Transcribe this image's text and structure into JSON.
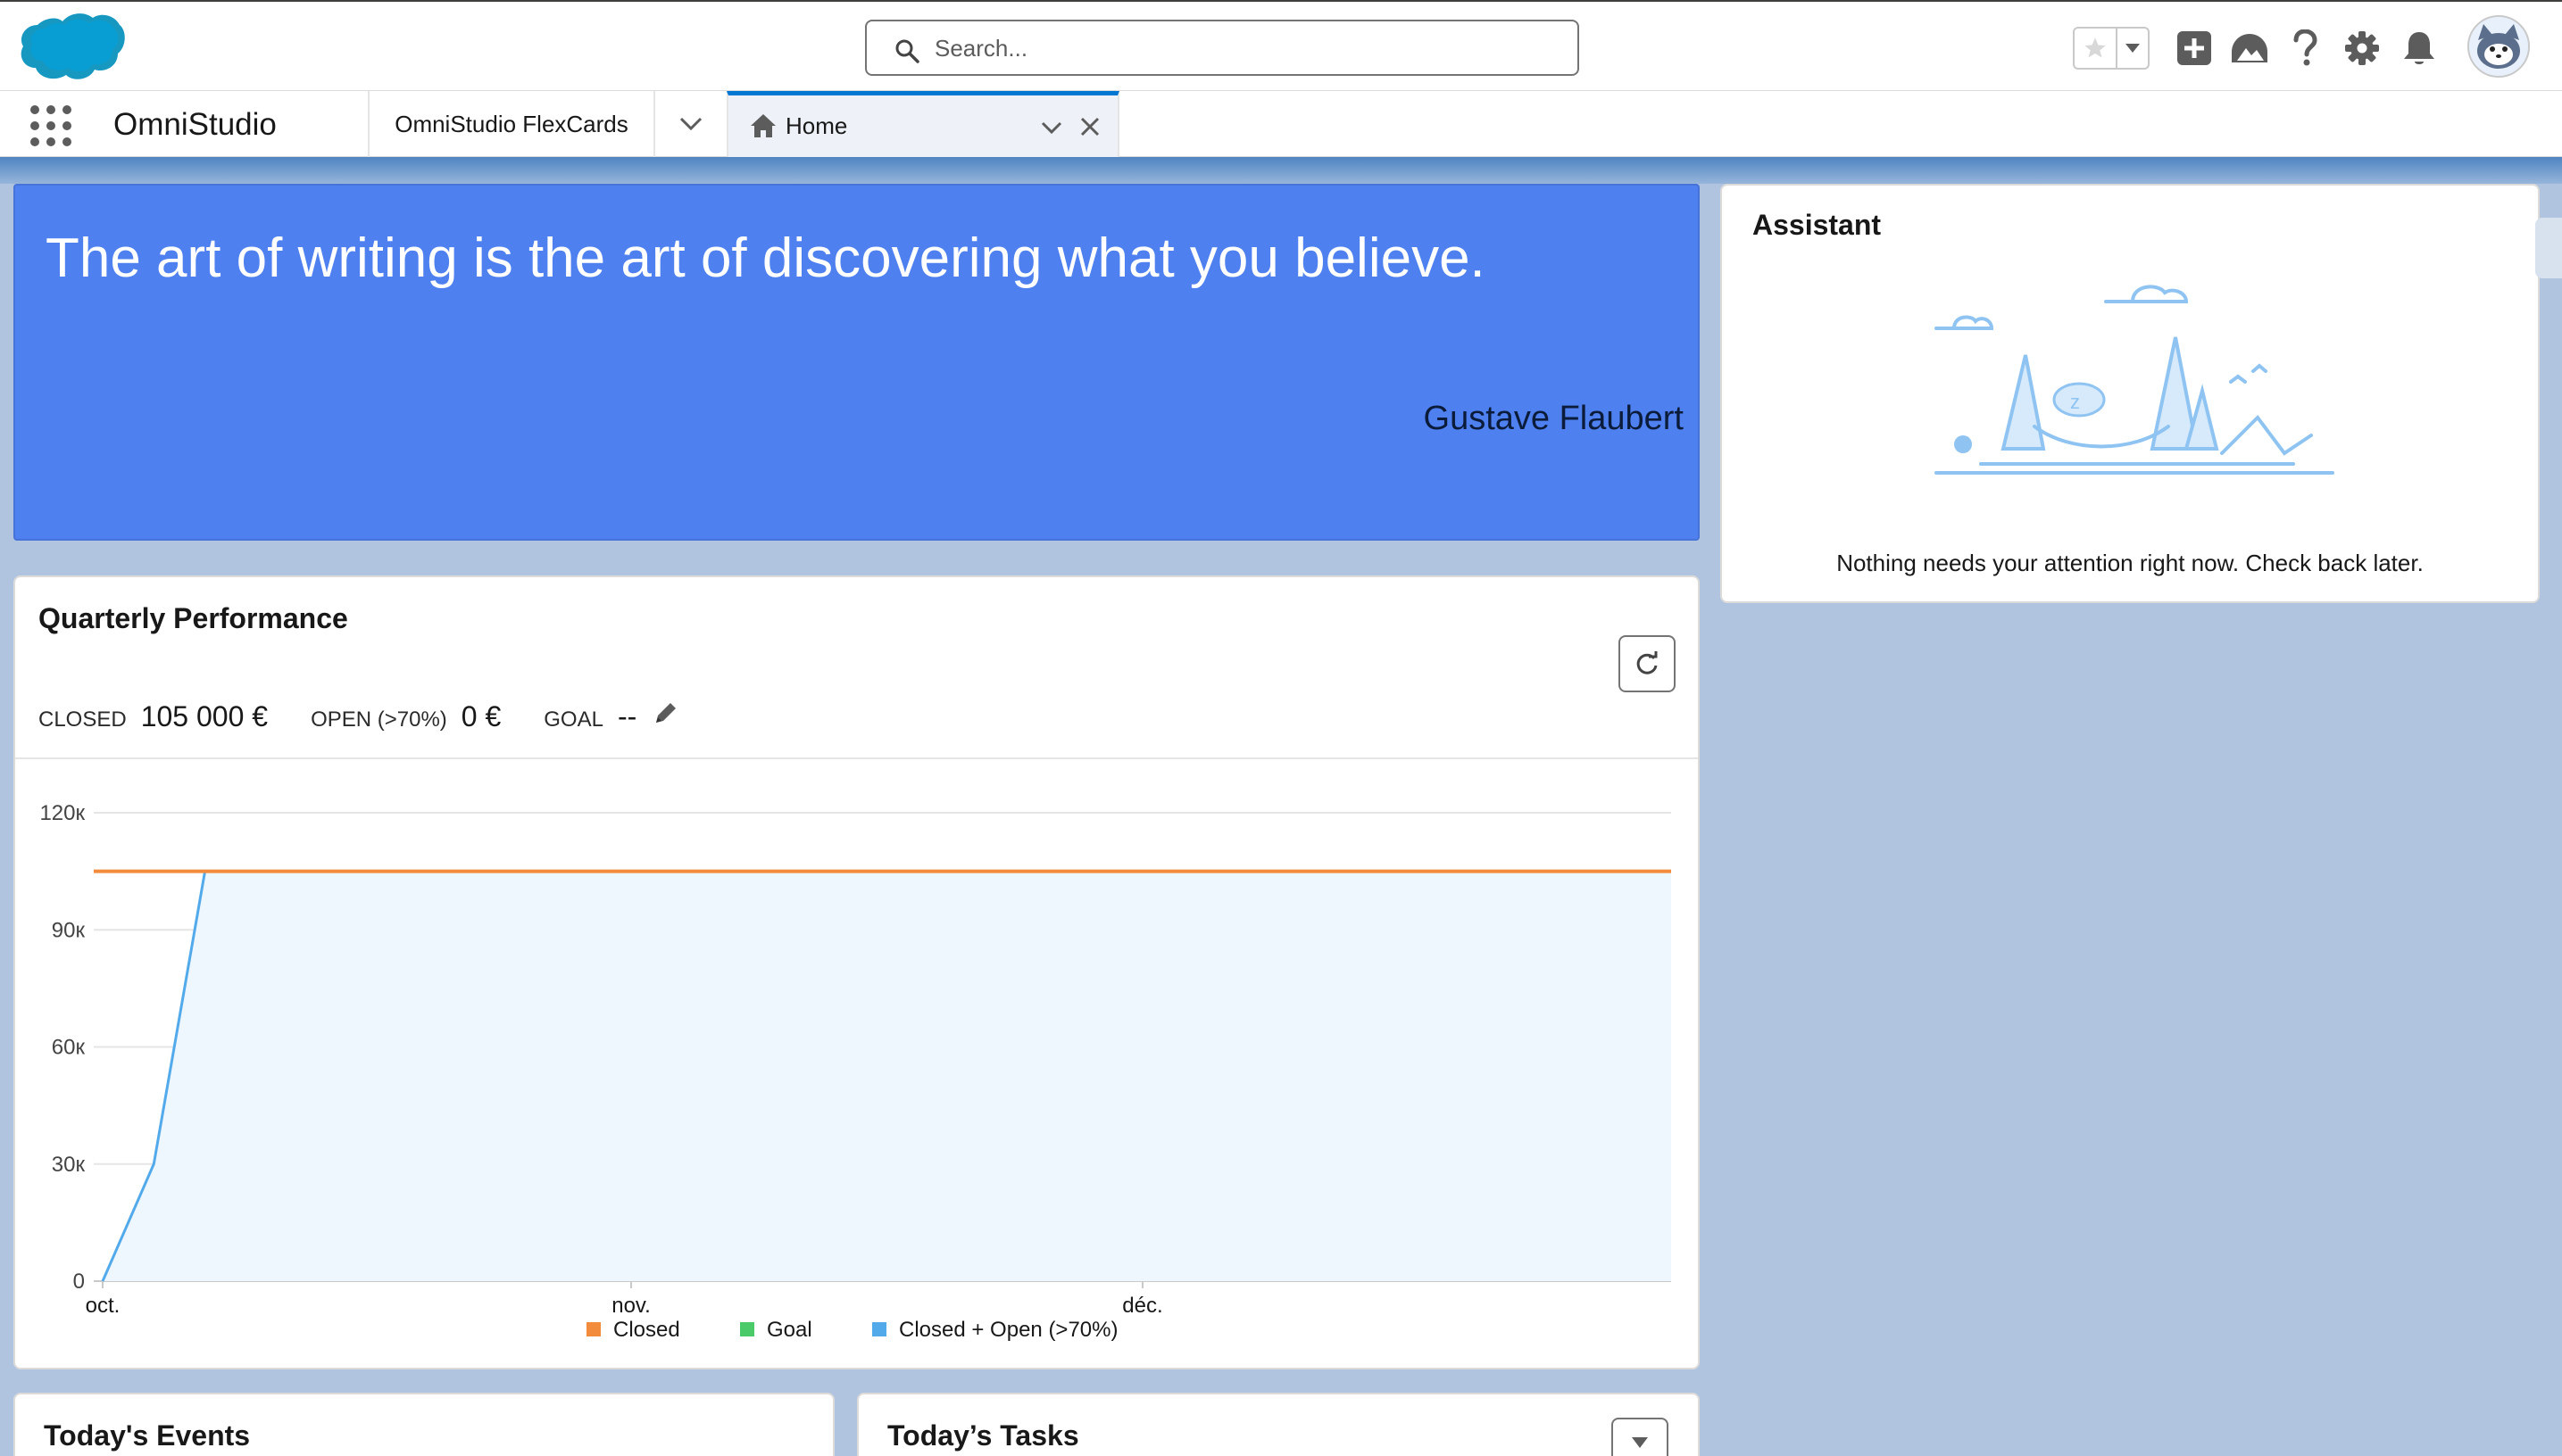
{
  "header": {
    "search_placeholder": "Search...",
    "icons": [
      "salesforce-cloud-logo",
      "search-icon",
      "favorite-star-icon",
      "chevron-down-icon",
      "global-add-icon",
      "trailhead-icon",
      "help-icon",
      "setup-gear-icon",
      "notification-bell-icon",
      "user-avatar"
    ]
  },
  "nav": {
    "app_name": "OmniStudio",
    "tabs": [
      {
        "label": "OmniStudio FlexCards"
      },
      {
        "label": "Home",
        "active": true
      }
    ]
  },
  "quote": {
    "text": "The art of writing is the art of discovering what you believe.",
    "author": "Gustave Flaubert",
    "background_color": "#4f80ef"
  },
  "assistant": {
    "title": "Assistant",
    "message": "Nothing needs your attention right now. Check back later."
  },
  "performance": {
    "title": "Quarterly Performance",
    "closed_label": "CLOSED",
    "closed_value": "105 000 €",
    "open_label": "OPEN (>70%)",
    "open_value": "0 €",
    "goal_label": "GOAL",
    "goal_value": "--"
  },
  "chart_data": {
    "type": "area",
    "x_ticks": [
      "oct.",
      "nov.",
      "déc."
    ],
    "y_ticks": [
      "0",
      "30к",
      "60к",
      "90к",
      "120к"
    ],
    "ylim": [
      0,
      120000
    ],
    "grid": true,
    "legend_position": "bottom",
    "series": [
      {
        "name": "Closed",
        "color": "#f28b3c",
        "x": [
          0,
          92
        ],
        "values": [
          105000,
          105000
        ]
      },
      {
        "name": "Goal",
        "color": "#4bca6a",
        "x": [],
        "values": []
      },
      {
        "name": "Closed + Open (>70%)",
        "color": "#52aaeb",
        "x": [
          0,
          3,
          6,
          92
        ],
        "values": [
          0,
          30000,
          105000,
          105000
        ]
      }
    ],
    "x_range_days": [
      0,
      92
    ]
  },
  "events": {
    "title": "Today's Events"
  },
  "tasks": {
    "title": "Today’s Tasks"
  }
}
